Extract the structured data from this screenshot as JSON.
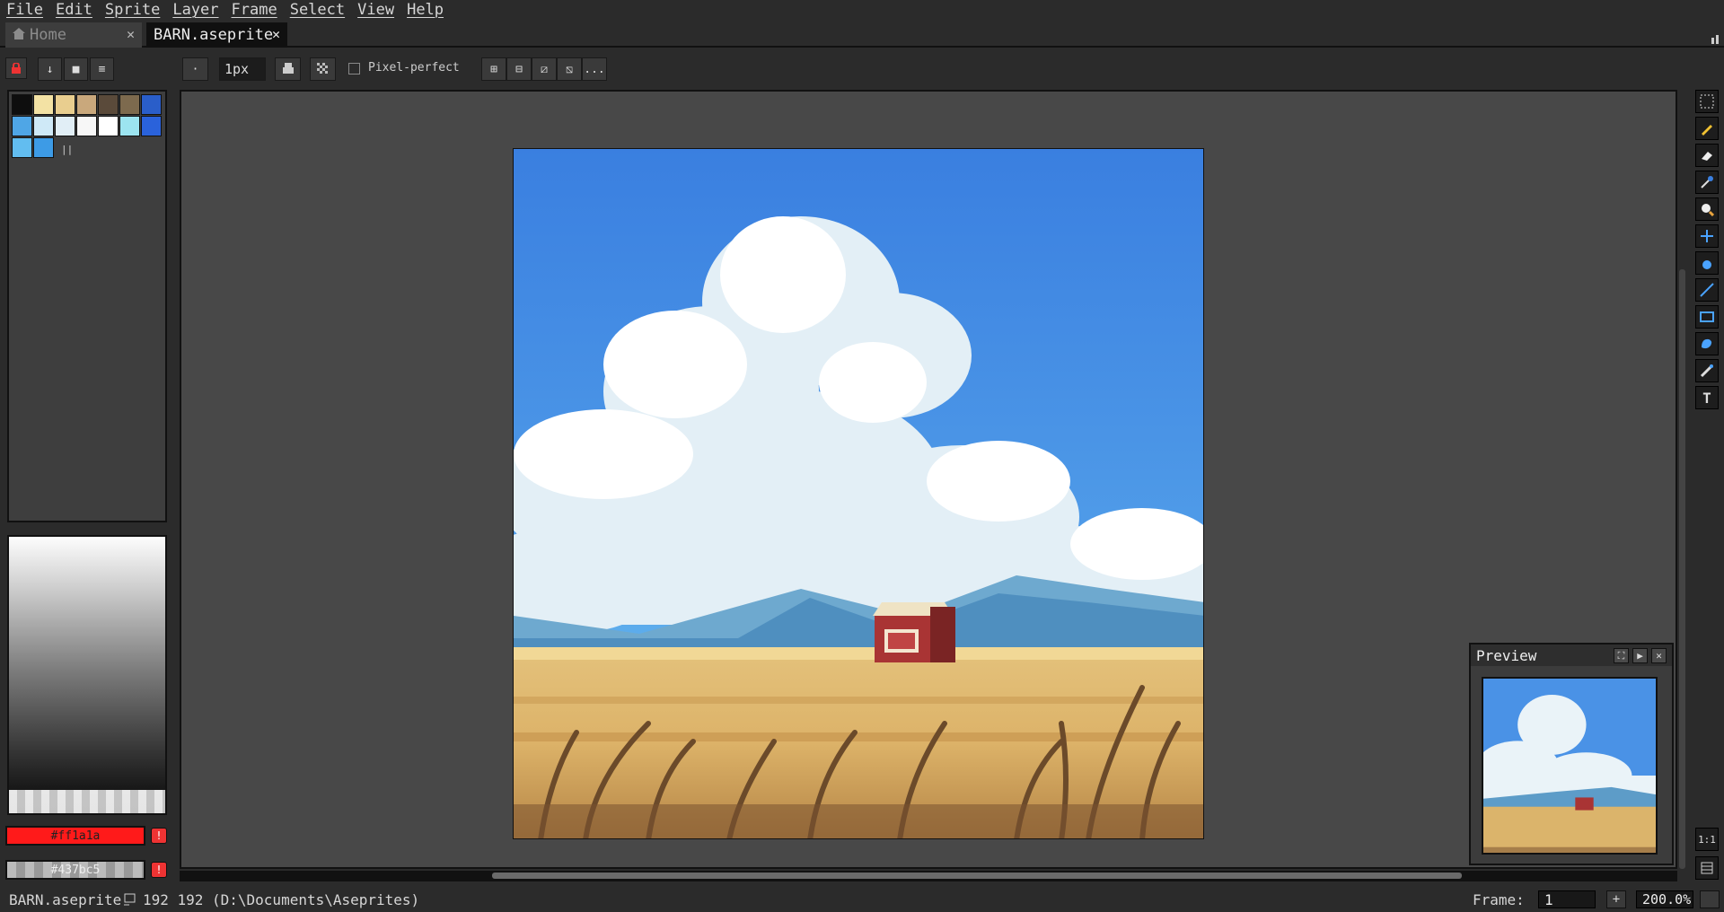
{
  "menu": [
    "File",
    "Edit",
    "Sprite",
    "Layer",
    "Frame",
    "Select",
    "View",
    "Help"
  ],
  "tabs": {
    "home": {
      "label": "Home"
    },
    "active": {
      "label": "BARN.aseprite"
    }
  },
  "toolbar": {
    "brush_size": "1px",
    "pixel_perfect_label": "Pixel-perfect",
    "pixel_perfect_checked": false,
    "more_label": "..."
  },
  "palette": {
    "colors": [
      "#0e0e0e",
      "#f3e2a4",
      "#e9ce8f",
      "#c9a87c",
      "#5a4a3a",
      "#7d6a4e",
      "#2a5ec9",
      "#4fa6e6",
      "#cfe9f7",
      "#e1eef6",
      "#f7f7f7",
      "#ffffff",
      "#9ce4f0",
      "#2a62db",
      "#62bdf0",
      "#3d9be6"
    ]
  },
  "colors": {
    "foreground_hex": "#ff1a1a",
    "foreground_label": "#ff1a1a",
    "background_label": "#437bc5"
  },
  "preview": {
    "title": "Preview"
  },
  "status": {
    "filename": "BARN.aseprite",
    "dims": "192 192",
    "path": "(D:\\Documents\\Aseprites)",
    "frame_label": "Frame:",
    "frame_value": "1",
    "zoom": "200.0%"
  }
}
